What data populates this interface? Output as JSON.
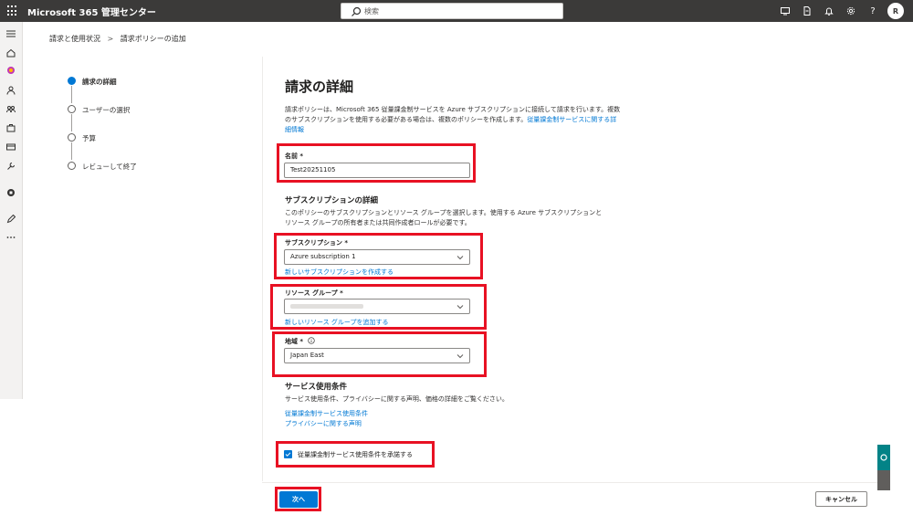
{
  "header": {
    "app_title": "Microsoft 365 管理センター",
    "search_placeholder": "検索",
    "icons": [
      "monitor-icon",
      "document-icon",
      "bell-icon",
      "gear-icon",
      "help-icon"
    ],
    "help_label": "?",
    "avatar_initial": "R"
  },
  "rail": {
    "icons": [
      "menu-icon",
      "home-icon",
      "copilot-icon",
      "user-icon",
      "group-icon",
      "billing-icon",
      "card-icon",
      "wrench-icon",
      "exchange-icon",
      "pen-icon",
      "more-icon"
    ]
  },
  "breadcrumb": {
    "items": [
      "請求と使用状況",
      "請求ポリシーの追加"
    ],
    "separator": ">"
  },
  "steps": [
    {
      "label": "請求の詳細",
      "active": true
    },
    {
      "label": "ユーザーの選択",
      "active": false
    },
    {
      "label": "予算",
      "active": false
    },
    {
      "label": "レビューして終了",
      "active": false
    }
  ],
  "form": {
    "title": "請求の詳細",
    "description": "請求ポリシーは、Microsoft 365 従量課金制サービスを Azure サブスクリプションに接続して請求を行います。複数のサブスクリプションを使用する必要がある場合は、複数のポリシーを作成します。",
    "description_link": "従量課金制サービスに関する詳細情報",
    "name_label": "名前 *",
    "name_value": "Test20251105",
    "subscription_section_title": "サブスクリプションの詳細",
    "subscription_section_desc": "このポリシーのサブスクリプションとリソース グループを選択します。使用する Azure サブスクリプションとリソース グループの所有者または共同作成者ロールが必要です。",
    "subscription_label": "サブスクリプション *",
    "subscription_value": "Azure subscription 1",
    "subscription_link": "新しいサブスクリプションを作成する",
    "resource_group_label": "リソース グループ *",
    "resource_group_link": "新しいリソース グループを追加する",
    "region_label": "地域 *",
    "region_value": "Japan East",
    "terms_section_title": "サービス使用条件",
    "terms_section_desc": "サービス使用条件、プライバシーに関する声明、価格の詳細をご覧ください。",
    "terms_link_1": "従量課金制サービス使用条件",
    "terms_link_2": "プライバシーに関する声明",
    "accept_checkbox_label": "従量課金制サービス使用条件を承諾する",
    "accept_checked": true
  },
  "footer": {
    "next_label": "次へ",
    "cancel_label": "キャンセル"
  },
  "colors": {
    "topbar": "#3b3a39",
    "accent": "#0078d4",
    "highlight": "#e81123"
  }
}
